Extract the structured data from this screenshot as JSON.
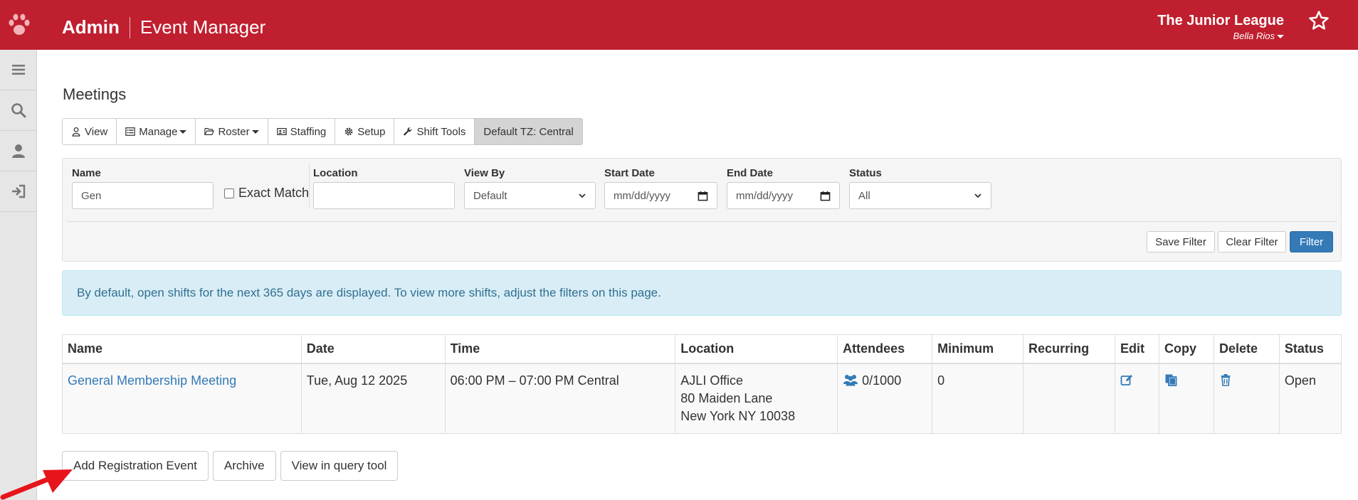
{
  "header": {
    "admin": "Admin",
    "app": "Event Manager",
    "org_name": "The Junior League",
    "user_name": "Bella Rios",
    "brand_color": "#c01f2f"
  },
  "sidebar": {
    "items": [
      {
        "icon": "menu-icon"
      },
      {
        "icon": "search-icon"
      },
      {
        "icon": "user-icon"
      },
      {
        "icon": "sign-out-icon"
      }
    ]
  },
  "page": {
    "title": "Meetings"
  },
  "toolbar": {
    "view": "View",
    "manage": "Manage",
    "roster": "Roster",
    "staffing": "Staffing",
    "setup": "Setup",
    "shift_tools": "Shift Tools",
    "timezone": "Default TZ: Central"
  },
  "filters": {
    "name_label": "Name",
    "name_value": "Gen",
    "exact_match_label": "Exact Match",
    "location_label": "Location",
    "location_value": "",
    "view_by_label": "View By",
    "view_by_value": "Default",
    "start_date_label": "Start Date",
    "start_date_placeholder": "mm/dd/yyyy",
    "end_date_label": "End Date",
    "end_date_placeholder": "mm/dd/yyyy",
    "status_label": "Status",
    "status_value": "All",
    "save_filter": "Save Filter",
    "clear_filter": "Clear Filter",
    "filter": "Filter"
  },
  "alert": {
    "text": "By default, open shifts for the next 365 days are displayed. To view more shifts, adjust the filters on this page."
  },
  "table": {
    "headers": [
      "Name",
      "Date",
      "Time",
      "Location",
      "Attendees",
      "Minimum",
      "Recurring",
      "Edit",
      "Copy",
      "Delete",
      "Status"
    ],
    "rows": [
      {
        "name": "General Membership Meeting",
        "date": "Tue, Aug 12 2025",
        "time": "06:00 PM – 07:00 PM Central",
        "location_line1": "AJLI Office",
        "location_line2": "80 Maiden Lane",
        "location_line3": "New York NY 10038",
        "attendees": "0/1000",
        "minimum": "0",
        "recurring": "",
        "status": "Open"
      }
    ]
  },
  "actions": {
    "add_registration_event": "Add Registration Event",
    "archive": "Archive",
    "view_in_query_tool": "View in query tool"
  },
  "colors": {
    "link": "#337ab7",
    "alert_bg": "#d9edf7",
    "alert_text": "#31708f",
    "primary_button": "#337ab7",
    "annotation_arrow": "#e8141c"
  }
}
